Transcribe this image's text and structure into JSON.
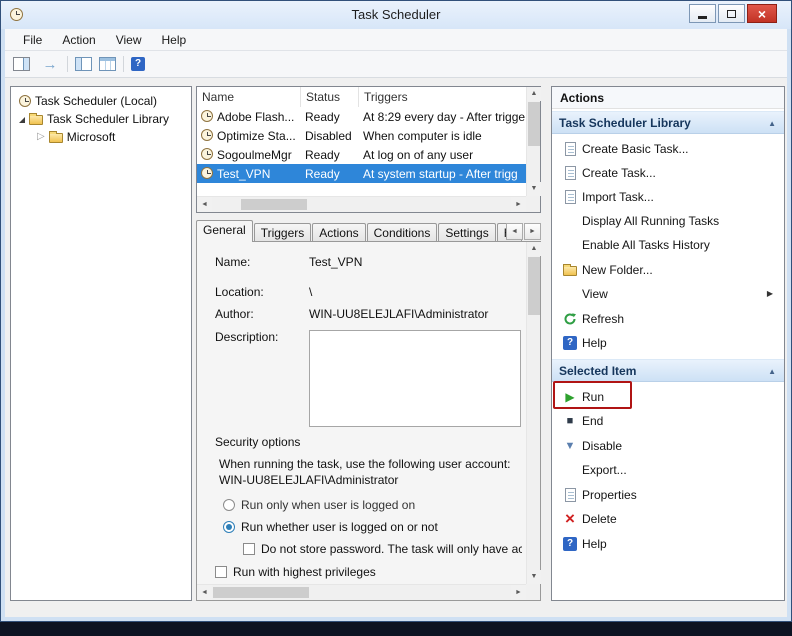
{
  "window": {
    "title": "Task Scheduler"
  },
  "menu": {
    "items": [
      "File",
      "Action",
      "View",
      "Help"
    ]
  },
  "tree": {
    "root": "Task Scheduler (Local)",
    "library": "Task Scheduler Library",
    "child": "Microsoft"
  },
  "task_list": {
    "columns": [
      "Name",
      "Status",
      "Triggers"
    ],
    "rows": [
      {
        "name": "Adobe Flash...",
        "status": "Ready",
        "triggers": "At 8:29 every day - After trigge"
      },
      {
        "name": "Optimize Sta...",
        "status": "Disabled",
        "triggers": "When computer is idle"
      },
      {
        "name": "SogoulmeMgr",
        "status": "Ready",
        "triggers": "At log on of any user"
      },
      {
        "name": "Test_VPN",
        "status": "Ready",
        "triggers": "At system startup - After trigg"
      }
    ]
  },
  "tabs": [
    "General",
    "Triggers",
    "Actions",
    "Conditions",
    "Settings",
    "Hi"
  ],
  "general": {
    "name_label": "Name:",
    "name_value": "Test_VPN",
    "location_label": "Location:",
    "location_value": "\\",
    "author_label": "Author:",
    "author_value": "WIN-UU8ELEJLAFI\\Administrator",
    "description_label": "Description:",
    "security_options_title": "Security options",
    "user_account_text": "When running the task, use the following user account:",
    "user_account_value": "WIN-UU8ELEJLAFI\\Administrator",
    "radio_logged_on": "Run only when user is logged on",
    "radio_whether": "Run whether user is logged on or not",
    "check_no_password": "Do not store password.  The task will only have ac",
    "check_highest": "Run with highest privileges"
  },
  "actions_pane": {
    "title": "Actions",
    "library_header": "Task Scheduler Library",
    "selected_header": "Selected Item",
    "library_items": [
      {
        "label": "Create Basic Task..."
      },
      {
        "label": "Create Task..."
      },
      {
        "label": "Import Task..."
      },
      {
        "label": "Display All Running Tasks"
      },
      {
        "label": "Enable All Tasks History"
      },
      {
        "label": "New Folder..."
      },
      {
        "label": "View"
      },
      {
        "label": "Refresh"
      },
      {
        "label": "Help"
      }
    ],
    "selected_items": [
      {
        "label": "Run"
      },
      {
        "label": "End"
      },
      {
        "label": "Disable"
      },
      {
        "label": "Export..."
      },
      {
        "label": "Properties"
      },
      {
        "label": "Delete"
      },
      {
        "label": "Help"
      }
    ]
  },
  "icons": {
    "close": "×",
    "back": "←",
    "forward": "→",
    "help_glyph": "?",
    "collapsed_expander": "▷",
    "chevron_up": "▲",
    "submenu_arrow": "▶",
    "scroll_up": "▲",
    "scroll_down": "▼",
    "scroll_left": "◄",
    "scroll_right": "►",
    "run": "▶",
    "end": "■",
    "disable": "▼",
    "delete": "×"
  }
}
